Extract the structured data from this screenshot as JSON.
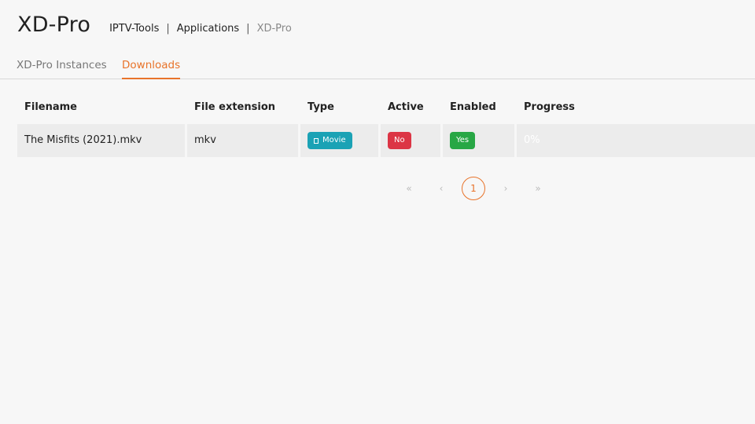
{
  "header": {
    "title": "XD-Pro",
    "breadcrumb": [
      "IPTV-Tools",
      "Applications",
      "XD-Pro"
    ]
  },
  "tabs": [
    {
      "label": "XD-Pro Instances",
      "active": false
    },
    {
      "label": "Downloads",
      "active": true
    }
  ],
  "table": {
    "columns": [
      "Filename",
      "File extension",
      "Type",
      "Active",
      "Enabled",
      "Progress"
    ],
    "rows": [
      {
        "filename": "The Misfits (2021).mkv",
        "extension": "mkv",
        "type": "Movie",
        "type_icon": "film-icon",
        "active": "No",
        "enabled": "Yes",
        "progress": "0%"
      }
    ]
  },
  "pagination": {
    "first": "«",
    "prev": "‹",
    "current": "1",
    "next": "›",
    "last": "»"
  },
  "colors": {
    "accent": "#e8732a",
    "movie": "#1ba2b5",
    "no": "#dc3545",
    "yes": "#28a745"
  }
}
